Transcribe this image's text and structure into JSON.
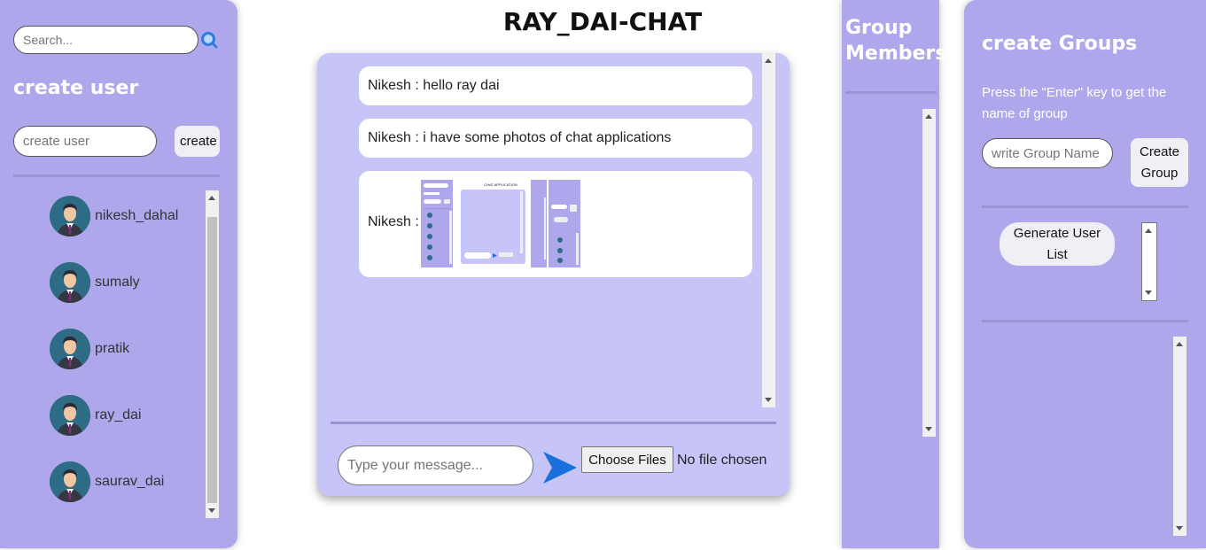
{
  "sidebar": {
    "search_placeholder": "Search...",
    "create_user_heading": "create user",
    "create_user_placeholder": "create user",
    "create_button": "create",
    "users": [
      {
        "name": "nikesh_dahal"
      },
      {
        "name": "sumaly"
      },
      {
        "name": "pratik"
      },
      {
        "name": "ray_dai"
      },
      {
        "name": "saurav_dai"
      }
    ]
  },
  "header": {
    "title": "RAY_DAI-CHAT"
  },
  "chat": {
    "messages": [
      {
        "text": "Nikesh : hello ray dai"
      },
      {
        "text": "Nikesh : i have some photos of chat applications"
      },
      {
        "text": "Nikesh :",
        "attachment": "image"
      }
    ],
    "thumbnail_title": "CHAT APPLICATION",
    "input_placeholder": "Type your message...",
    "choose_files_label": "Choose Files",
    "no_file_text": "No file chosen"
  },
  "members": {
    "heading_line1": "Group",
    "heading_line2": "Members"
  },
  "groups": {
    "heading": "create Groups",
    "hint": "Press the \"Enter\" key to get the name of group",
    "name_placeholder": "write Group Name",
    "create_group_line1": "Create",
    "create_group_line2": "Group",
    "generate_line1": "Generate User",
    "generate_line2": "List"
  },
  "colors": {
    "panel": "#aea7eb",
    "chat_bg": "#c7c5f7",
    "send_icon": "#1a6fdc"
  }
}
